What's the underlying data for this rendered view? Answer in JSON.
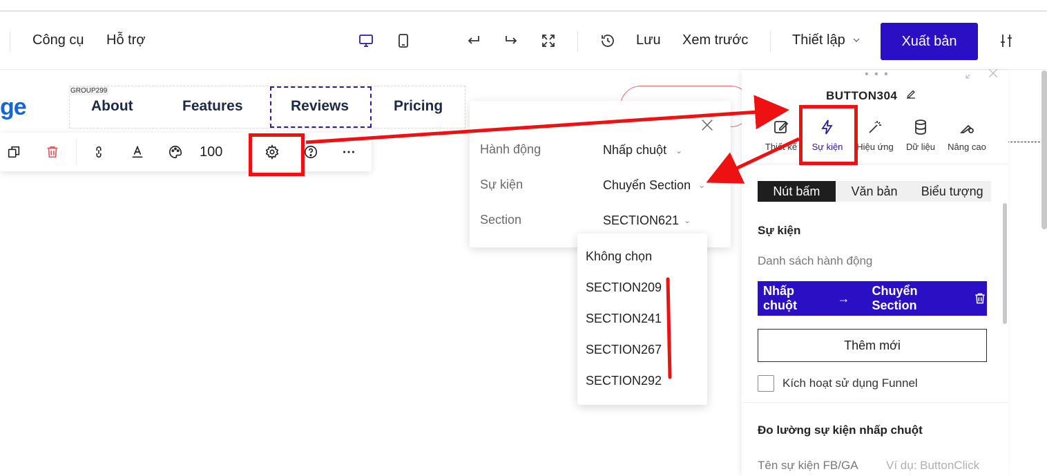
{
  "topbar": {
    "menu_tools": "Công cụ",
    "menu_support": "Hỗ trợ",
    "save_label": "Lưu",
    "preview_label": "Xem trước",
    "settings_label": "Thiết lập",
    "publish_label": "Xuất bản"
  },
  "canvas": {
    "logo_fragment": "ge",
    "group_tag": "GROUP299",
    "nav": [
      "About",
      "Features",
      "Reviews",
      "Pricing"
    ],
    "toolbar_opacity": "100"
  },
  "popup": {
    "action_label": "Hành động",
    "action_value": "Nhấp chuột",
    "event_label": "Sự kiện",
    "event_value": "Chuyển Section",
    "section_label": "Section",
    "section_value": "SECTION621"
  },
  "dropdown": {
    "items": [
      "Không chọn",
      "SECTION209",
      "SECTION241",
      "SECTION267",
      "SECTION292"
    ]
  },
  "panel": {
    "title": "BUTTON304",
    "tabs": [
      "Thiết kế",
      "Sự kiện",
      "Hiệu ứng",
      "Dữ liệu",
      "Nâng cao"
    ],
    "segments": [
      "Nút bấm",
      "Văn bản",
      "Biểu tượng"
    ],
    "section_event": "Sự kiện",
    "action_list_label": "Danh sách hành động",
    "action_trigger": "Nhấp chuột",
    "action_target": "Chuyển Section",
    "add_new": "Thêm mới",
    "funnel_label": "Kích hoạt sử dụng Funnel",
    "measure_title": "Đo lường sự kiện nhấp chuột",
    "fbga_label": "Tên sự kiện FB/GA",
    "fbga_placeholder": "Ví dụ: ButtonClick"
  },
  "colors": {
    "accent": "#2b0fc4",
    "annotation": "#ee1111",
    "logo": "#1565d8",
    "delete": "#e25555"
  }
}
